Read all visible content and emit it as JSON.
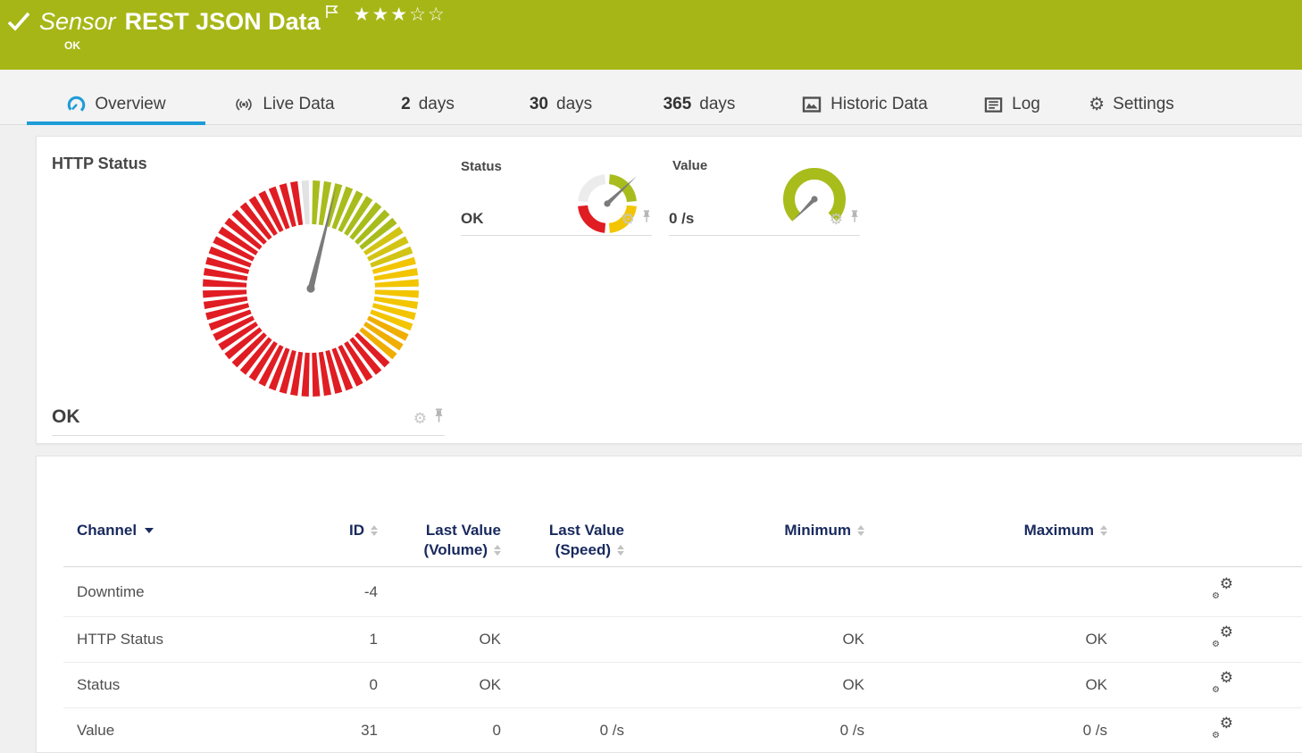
{
  "header": {
    "kind_label": "Sensor",
    "title": "REST JSON Data",
    "status_text": "OK",
    "rating_filled": "★★★",
    "rating_empty": "☆☆",
    "bg_color": "#a6b616"
  },
  "tabs": [
    {
      "id": "overview",
      "label": "Overview",
      "icon": "gauge-icon",
      "active": true
    },
    {
      "id": "live-data",
      "label": "Live Data",
      "icon": "broadcast-icon",
      "active": false
    },
    {
      "id": "2-days",
      "num": "2",
      "label": "days",
      "active": false
    },
    {
      "id": "30-days",
      "num": "30",
      "label": "days",
      "active": false
    },
    {
      "id": "365-days",
      "num": "365",
      "label": "days",
      "active": false
    },
    {
      "id": "historic-data",
      "label": "Historic Data",
      "icon": "chart-icon",
      "active": false
    },
    {
      "id": "log",
      "label": "Log",
      "icon": "log-icon",
      "active": false
    },
    {
      "id": "settings",
      "label": "Settings",
      "icon": "settings-gear-icon",
      "active": false
    }
  ],
  "panels": {
    "http_status": {
      "title": "HTTP Status",
      "value": "OK"
    },
    "status": {
      "title": "Status",
      "value": "OK"
    },
    "value": {
      "title": "Value",
      "value": "0 /s"
    }
  },
  "gauges": {
    "http_status": {
      "type": "tick-ring",
      "needle_angle": 14,
      "needle_color": "#7b7b7b",
      "segments": [
        {
          "from": 0,
          "to": 57,
          "color": "#a8bc1c"
        },
        {
          "from": 57,
          "to": 72,
          "color": "#d2c414"
        },
        {
          "from": 72,
          "to": 117,
          "color": "#f2c500"
        },
        {
          "from": 117,
          "to": 133,
          "color": "#efae00"
        },
        {
          "from": 133,
          "to": 352,
          "color": "#e01d23"
        },
        {
          "from": 352,
          "to": 360,
          "color": "#e2e2e2"
        }
      ]
    },
    "status": {
      "type": "quad-ring",
      "needle_angle": 47,
      "needle_color": "#7b7b7b",
      "segments": [
        {
          "from": 5,
          "to": 85,
          "color": "#a8bc1c"
        },
        {
          "from": 95,
          "to": 175,
          "color": "#f2c500"
        },
        {
          "from": 185,
          "to": 265,
          "color": "#e01d23"
        },
        {
          "from": 275,
          "to": 355,
          "color": "#ececec"
        }
      ]
    },
    "value": {
      "type": "arc",
      "needle_angle": -135,
      "needle_color": "#7b7b7b",
      "segments": [
        {
          "from": -135,
          "to": 135,
          "color": "#a8bc1c"
        }
      ]
    }
  },
  "table": {
    "columns": [
      {
        "key": "channel",
        "line1": "Channel",
        "line2": "",
        "align": "left",
        "sort": "desc"
      },
      {
        "key": "id",
        "line1": "ID",
        "line2": "",
        "align": "right",
        "sort": "both"
      },
      {
        "key": "last_volume",
        "line1": "Last Value",
        "line2": "(Volume)",
        "align": "right",
        "sort": "both"
      },
      {
        "key": "last_speed",
        "line1": "Last Value",
        "line2": "(Speed)",
        "align": "right",
        "sort": "both"
      },
      {
        "key": "min",
        "line1": "Minimum",
        "line2": "",
        "align": "right",
        "sort": "both"
      },
      {
        "key": "max",
        "line1": "Maximum",
        "line2": "",
        "align": "right",
        "sort": "both"
      },
      {
        "key": "actions",
        "line1": "",
        "line2": "",
        "align": "left",
        "sort": "none"
      }
    ],
    "rows": [
      {
        "channel": "Downtime",
        "id": "-4",
        "last_volume": "",
        "last_speed": "",
        "min": "",
        "max": ""
      },
      {
        "channel": "HTTP Status",
        "id": "1",
        "last_volume": "OK",
        "last_speed": "",
        "min": "OK",
        "max": "OK"
      },
      {
        "channel": "Status",
        "id": "0",
        "last_volume": "OK",
        "last_speed": "",
        "min": "OK",
        "max": "OK"
      },
      {
        "channel": "Value",
        "id": "31",
        "last_volume": "0",
        "last_speed": "0 /s",
        "min": "0 /s",
        "max": "0 /s"
      }
    ]
  }
}
